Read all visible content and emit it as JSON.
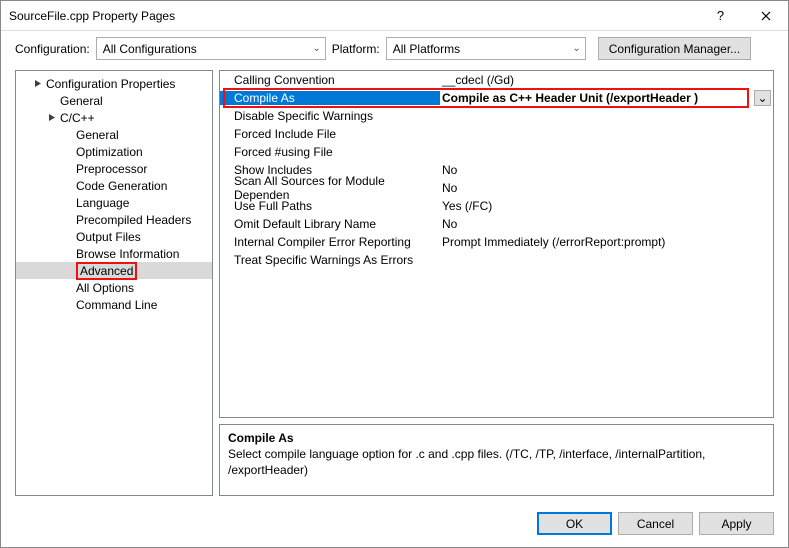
{
  "window": {
    "title": "SourceFile.cpp Property Pages"
  },
  "configRow": {
    "configLabel": "Configuration:",
    "configValue": "All Configurations",
    "platformLabel": "Platform:",
    "platformValue": "All Platforms",
    "managerBtn": "Configuration Manager..."
  },
  "tree": {
    "root": "Configuration Properties",
    "general": "General",
    "ccpp": "C/C++",
    "items": [
      "General",
      "Optimization",
      "Preprocessor",
      "Code Generation",
      "Language",
      "Precompiled Headers",
      "Output Files",
      "Browse Information",
      "Advanced",
      "All Options",
      "Command Line"
    ]
  },
  "grid": [
    {
      "name": "Calling Convention",
      "value": "__cdecl (/Gd)"
    },
    {
      "name": "Compile As",
      "value": "Compile as C++ Header Unit (/exportHeader )"
    },
    {
      "name": "Disable Specific Warnings",
      "value": ""
    },
    {
      "name": "Forced Include File",
      "value": ""
    },
    {
      "name": "Forced #using File",
      "value": ""
    },
    {
      "name": "Show Includes",
      "value": "No"
    },
    {
      "name": "Scan All Sources for Module Dependen",
      "value": "No"
    },
    {
      "name": "Use Full Paths",
      "value": "Yes (/FC)"
    },
    {
      "name": "Omit Default Library Name",
      "value": "No"
    },
    {
      "name": "Internal Compiler Error Reporting",
      "value": "Prompt Immediately (/errorReport:prompt)"
    },
    {
      "name": "Treat Specific Warnings As Errors",
      "value": ""
    }
  ],
  "description": {
    "title": "Compile As",
    "text": "Select compile language option for .c and .cpp files.     (/TC, /TP, /interface, /internalPartition, /exportHeader)"
  },
  "footer": {
    "ok": "OK",
    "cancel": "Cancel",
    "apply": "Apply"
  }
}
